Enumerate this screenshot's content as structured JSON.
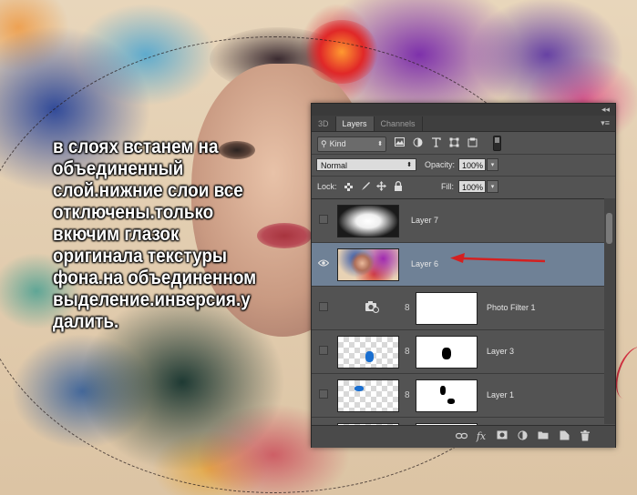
{
  "caption": "в слоях встанем на\nобъединенный\nслой.нижние слои все\nотключены.только\nвкючим глазок\nоригинала текстуры\nфона.на объединенном\nвыделение.инверсия.у\nдалить.",
  "panel": {
    "collapse_glyph": "◂◂",
    "menu_glyph": "▾≡",
    "tabs": [
      {
        "label": "3D"
      },
      {
        "label": "Layers"
      },
      {
        "label": "Channels"
      }
    ],
    "filter": {
      "kind_label": "Kind",
      "search_glyph": "⚲",
      "arrow_glyph": "⬍"
    },
    "blend": {
      "mode": "Normal",
      "opacity_label": "Opacity:",
      "opacity_value": "100%",
      "fill_label": "Fill:",
      "fill_value": "100%",
      "lock_label": "Lock:"
    },
    "layers": [
      {
        "name": "Layer 7",
        "visible": false,
        "thumb": "radial-mask"
      },
      {
        "name": "Layer 6",
        "visible": true,
        "selected": true,
        "thumb": "photo"
      },
      {
        "name": "Photo Filter 1",
        "visible": false,
        "thumb": "adjustment"
      },
      {
        "name": "Layer 3",
        "visible": false,
        "thumb": "masked"
      },
      {
        "name": "Layer 1",
        "visible": false,
        "thumb": "masked"
      }
    ],
    "eye_glyph": "👁",
    "chain_glyph": "8",
    "footer_icons": [
      "link-icon",
      "fx-icon",
      "add-mask-icon",
      "adjustment-layer-icon",
      "new-group-icon",
      "new-layer-icon",
      "trash-icon"
    ],
    "fx_label": "fx"
  },
  "colors": {
    "panel_bg": "#535353",
    "selected_row": "#6f8196",
    "arrow": "#d42020",
    "caption_text": "#ffffff"
  }
}
